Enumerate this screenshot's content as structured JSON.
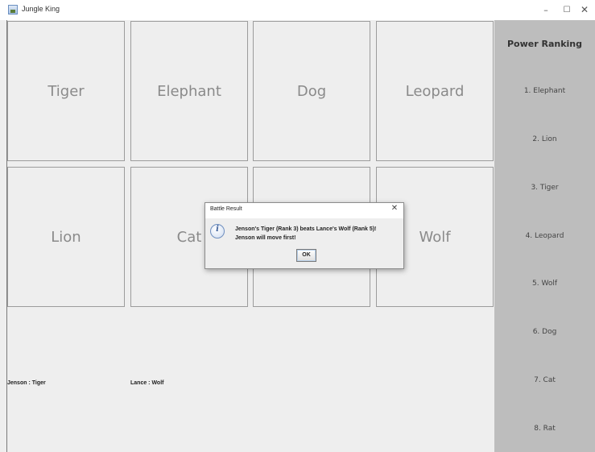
{
  "window": {
    "title": "Jungle King",
    "controls": {
      "minimize": "–",
      "maximize": "☐",
      "close": "✕"
    }
  },
  "board": {
    "cards": [
      {
        "animal": "Tiger"
      },
      {
        "animal": "Elephant"
      },
      {
        "animal": "Dog"
      },
      {
        "animal": "Leopard"
      },
      {
        "animal": "Lion"
      },
      {
        "animal": "Cat"
      },
      {
        "animal": ""
      },
      {
        "animal": "Wolf"
      }
    ]
  },
  "players": {
    "player1": "Jenson : Tiger",
    "player2": "Lance : Wolf"
  },
  "sidebar": {
    "title": "Power Ranking",
    "items": [
      "1. Elephant",
      "2. Lion",
      "3. Tiger",
      "4. Leopard",
      "5. Wolf",
      "6. Dog",
      "7. Cat",
      "8. Rat"
    ]
  },
  "dialog": {
    "title": "Battle Result",
    "close": "✕",
    "icon": "info-icon",
    "message_line1": "Jenson's Tiger (Rank 3) beats Lance's Wolf (Rank 5)!",
    "message_line2": "Jenson will move first!",
    "ok_label": "OK"
  }
}
